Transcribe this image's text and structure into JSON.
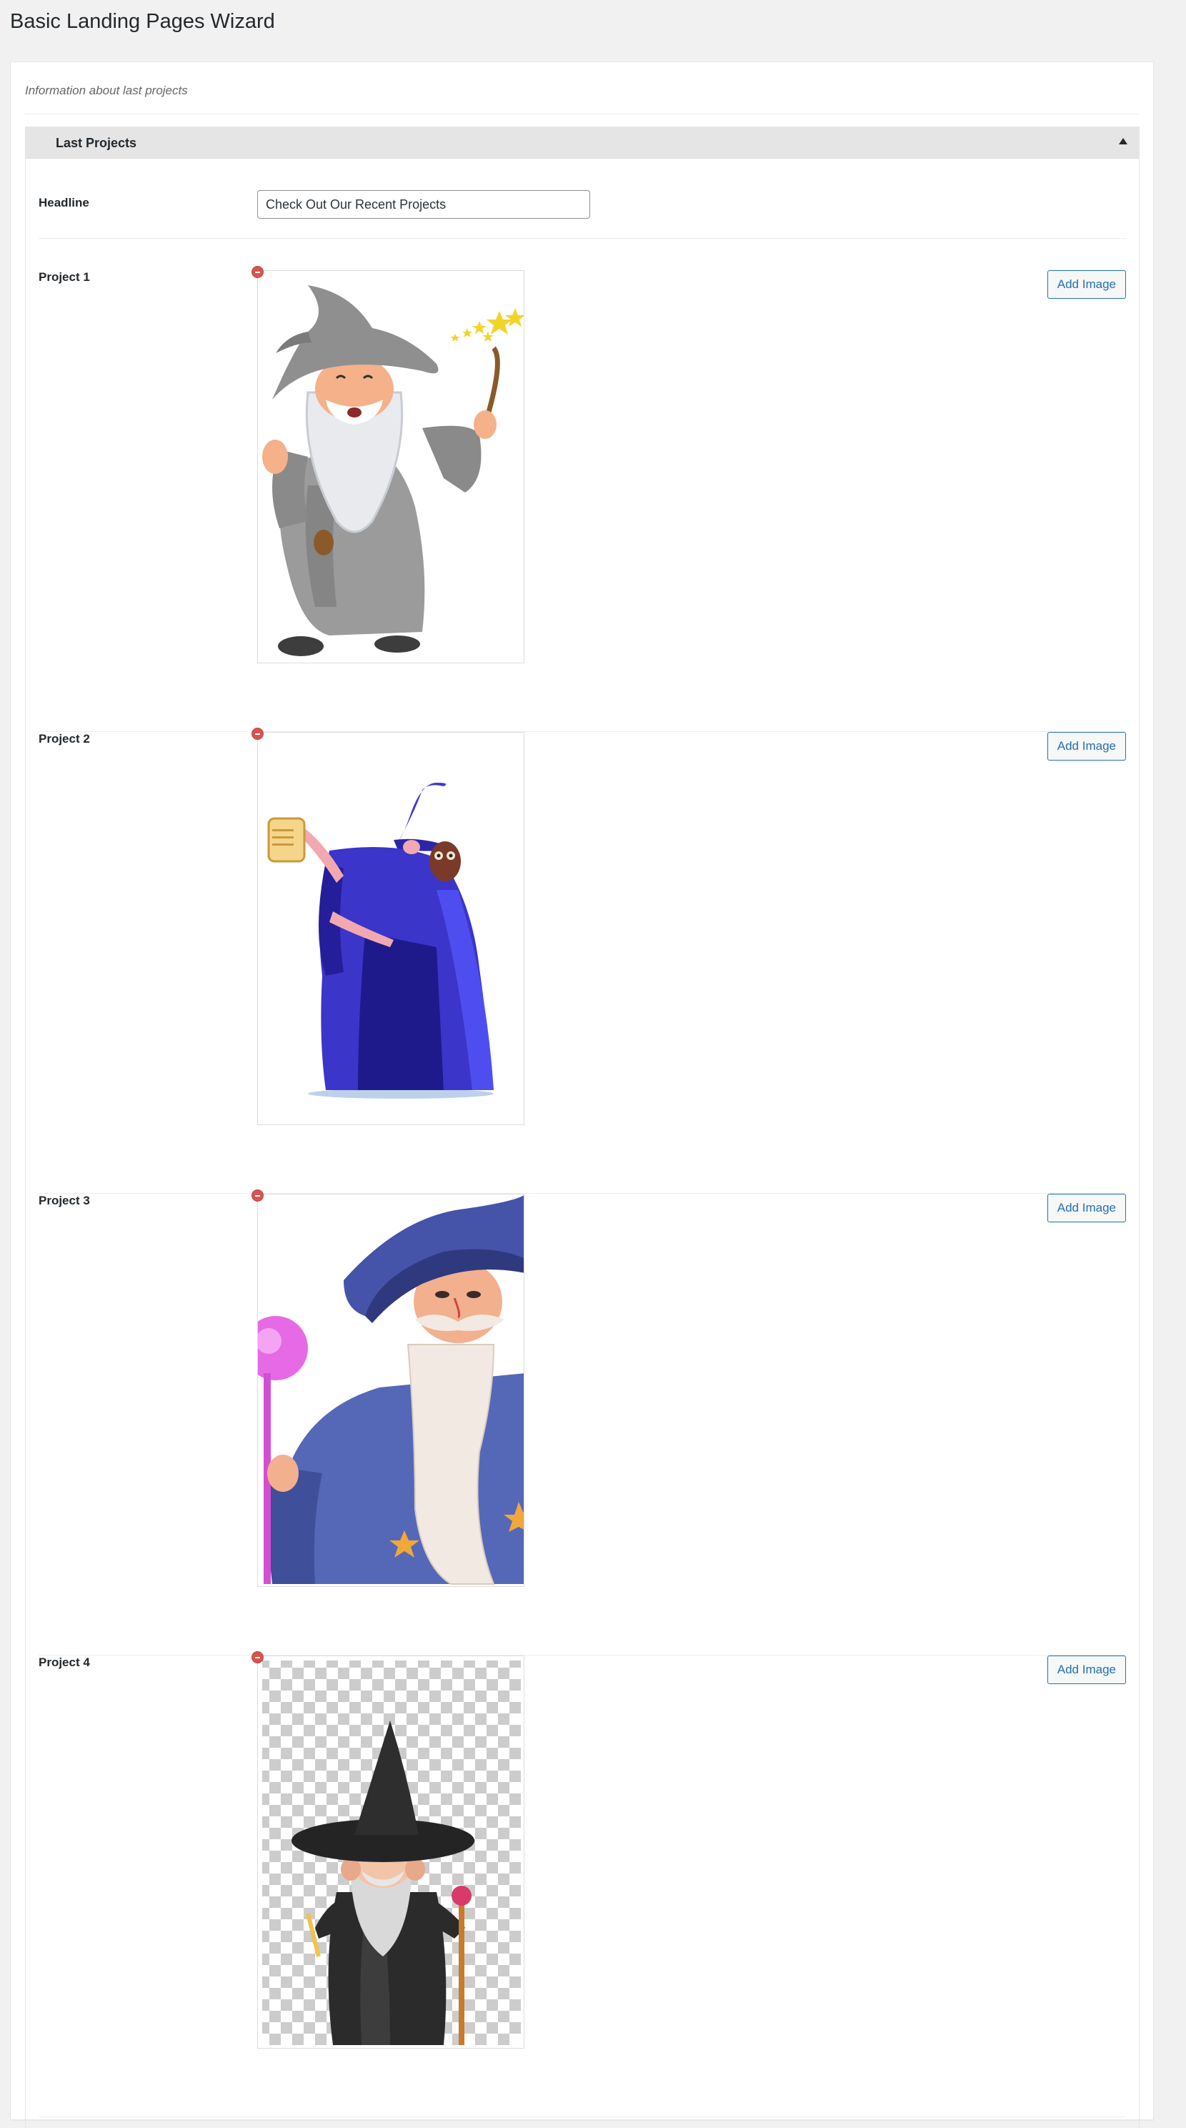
{
  "page": {
    "title": "Basic Landing Pages Wizard"
  },
  "box": {
    "description": "Information about last projects",
    "section_title": "Last Projects",
    "headline": {
      "label": "Headline",
      "value": "Check Out Our Recent Projects"
    }
  },
  "projects": [
    {
      "label": "Project 1",
      "add_label": "Add Image",
      "image": "grey-wizard-with-wand-and-stars"
    },
    {
      "label": "Project 2",
      "add_label": "Add Image",
      "image": "blue-wizard-with-owl-and-scroll"
    },
    {
      "label": "Project 3",
      "add_label": "Add Image",
      "image": "old-wizard-with-pink-staff"
    },
    {
      "label": "Project 4",
      "add_label": "Add Image",
      "image": "black-wizard-on-transparent-background"
    }
  ],
  "colors": {
    "accent": "#2271b1",
    "remove": "#d9534f",
    "header_bg": "#e5e5e5"
  },
  "icons": {
    "collapse": "triangle-up-icon",
    "remove": "remove-circle-icon"
  }
}
